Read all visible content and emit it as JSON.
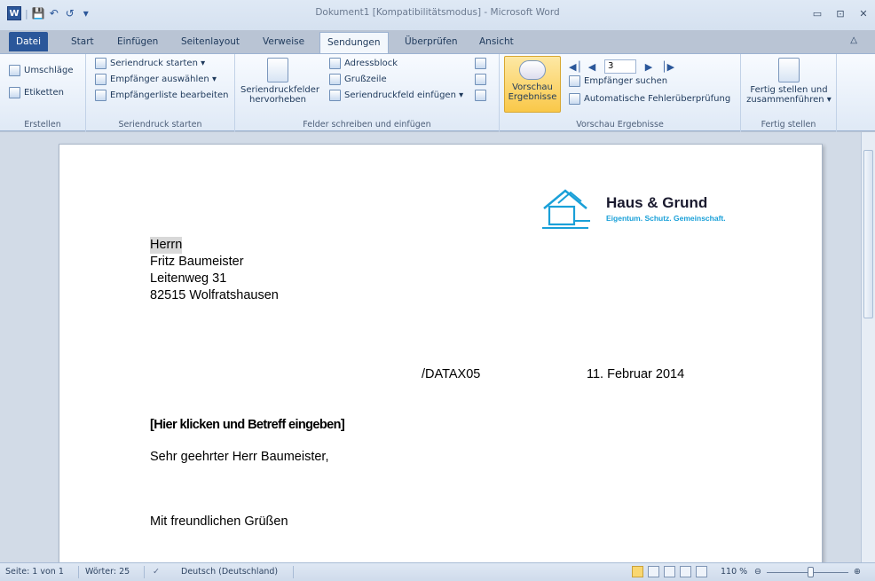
{
  "window": {
    "title": "Dokument1 [Kompatibilitätsmodus] - Microsoft Word",
    "app_icon_label": "W",
    "controls": [
      "▭",
      "⊡",
      "✕"
    ]
  },
  "tabs": [
    "Datei",
    "Start",
    "Einfügen",
    "Seitenlayout",
    "Verweise",
    "Sendungen",
    "Überprüfen",
    "Ansicht"
  ],
  "active_tab": "Sendungen",
  "ribbon": {
    "erstellen": {
      "label": "Erstellen",
      "umschlaege": "Umschläge",
      "etiketten": "Etiketten"
    },
    "seriendruck": {
      "label": "Seriendruck starten",
      "starten": "Seriendruck starten ▾",
      "empfaenger": "Empfänger auswählen ▾",
      "liste": "Empfängerliste bearbeiten"
    },
    "felder": {
      "label": "Felder schreiben und einfügen",
      "hervorheben": "Seriendruckfelder hervorheben",
      "adressblock": "Adressblock",
      "grusszeile": "Grußzeile",
      "feld_einfuegen": "Seriendruckfeld einfügen ▾"
    },
    "vorschau": {
      "label": "Vorschau Ergebnisse",
      "button": "Vorschau Ergebnisse",
      "record": "3",
      "suchen": "Empfänger suchen",
      "fehler": "Automatische Fehlerüberprüfung"
    },
    "fertig": {
      "label": "Fertig stellen",
      "button": "Fertig stellen und zusammenführen ▾"
    }
  },
  "document": {
    "logo_brand": "Haus & Grund",
    "logo_slogan": "Eigentum. Schutz. Gemeinschaft.",
    "salutation_line": "Herrn",
    "name": "Fritz Baumeister",
    "street": "Leitenweg 31",
    "city": "82515 Wolfratshausen",
    "reference": "/DATAX05",
    "date": "11. Februar 2014",
    "subject": "[Hier klicken und Betreff eingeben]",
    "greeting": "Sehr geehrter Herr Baumeister,",
    "closing": "Mit freundlichen Grüßen"
  },
  "statusbar": {
    "page": "Seite: 1 von 1",
    "words": "Wörter: 25",
    "language": "Deutsch (Deutschland)",
    "zoom": "110 %"
  },
  "colors": {
    "file_tab": "#2b579a",
    "accent_logo": "#1aa0d8",
    "preview_active": "#f9c849"
  }
}
